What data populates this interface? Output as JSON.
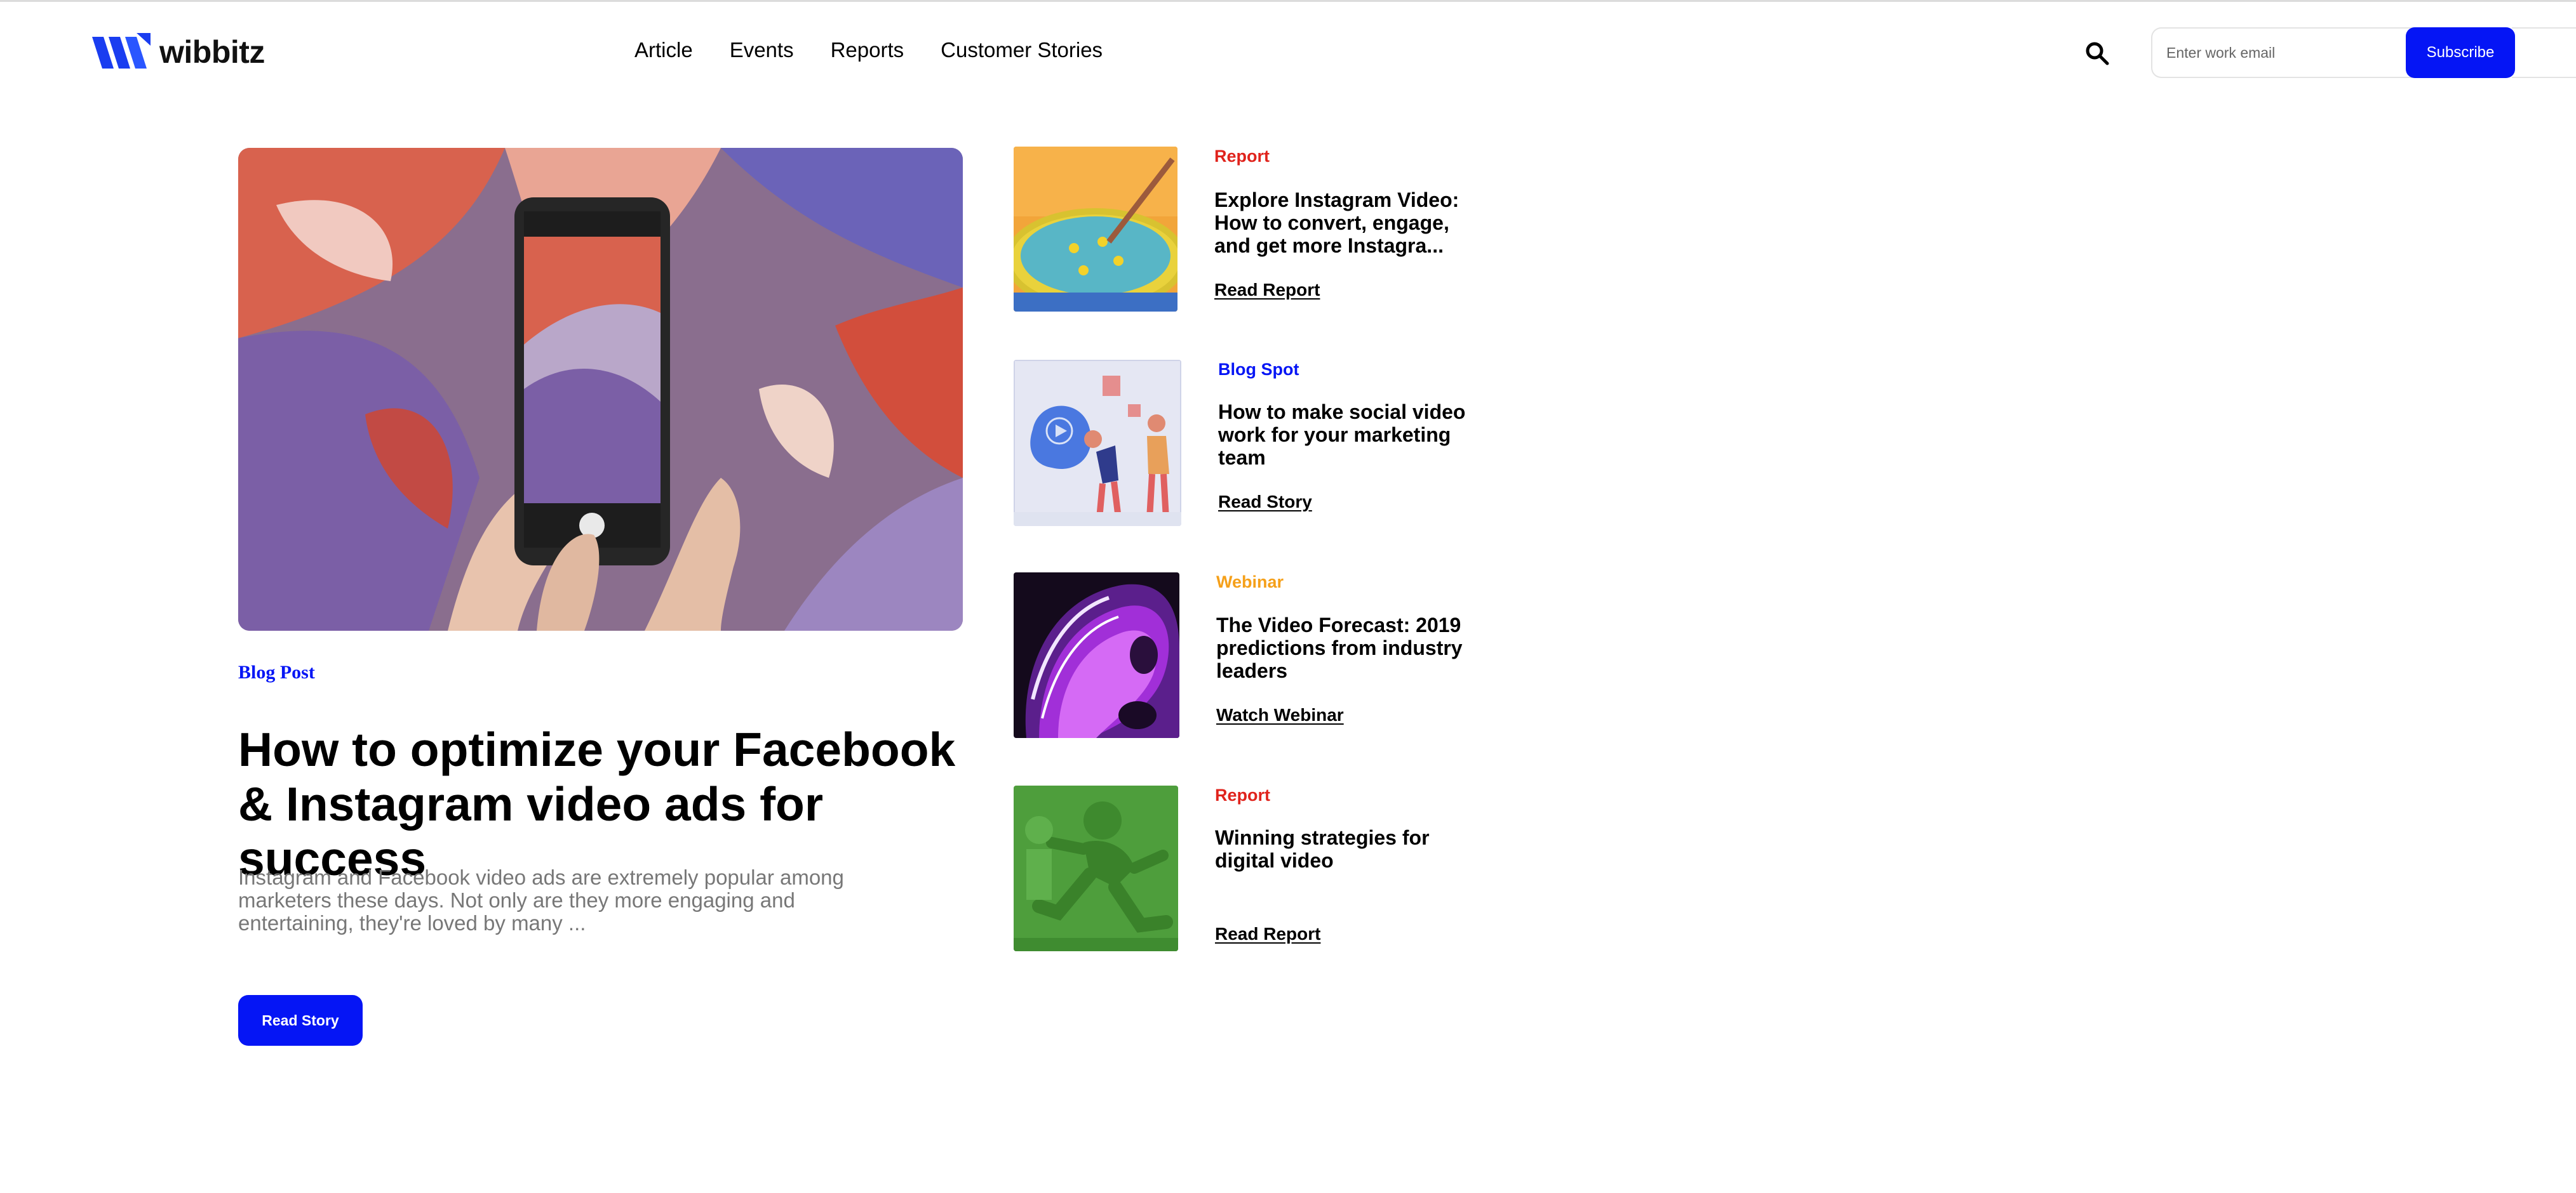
{
  "brand": {
    "name": "wibbitz",
    "color": "#1a3df0"
  },
  "nav": {
    "items": [
      {
        "label": "Article"
      },
      {
        "label": "Events"
      },
      {
        "label": "Reports"
      },
      {
        "label": "Customer Stories"
      }
    ]
  },
  "subscribe": {
    "placeholder": "Enter work email",
    "button_label": "Subscribe"
  },
  "featured": {
    "category": "Blog Post",
    "title": "How to optimize your Facebook & Instagram video ads for success",
    "excerpt": "Instagram and Facebook video ads are extremely popular among marketers these days. Not only are they more engaging and entertaining, they're loved by many ...",
    "cta": "Read Story"
  },
  "cards": [
    {
      "category": "Report",
      "category_color": "#e0231c",
      "title": "Explore Instagram Video: How to convert, engage, and get more Instagra...",
      "cta": "Read Report"
    },
    {
      "category": "Blog Spot",
      "category_color": "#0515f5",
      "title": "How to make social video work for your marketing team",
      "cta": "Read Story"
    },
    {
      "category": "Webinar",
      "category_color": "#f5a01a",
      "title": "The Video Forecast: 2019 predictions from industry leaders",
      "cta": "Watch Webinar"
    },
    {
      "category": "Report",
      "category_color": "#e0231c",
      "title": "Winning strategies for digital video",
      "cta": "Read Report"
    }
  ],
  "colors": {
    "accent": "#0515f5"
  }
}
